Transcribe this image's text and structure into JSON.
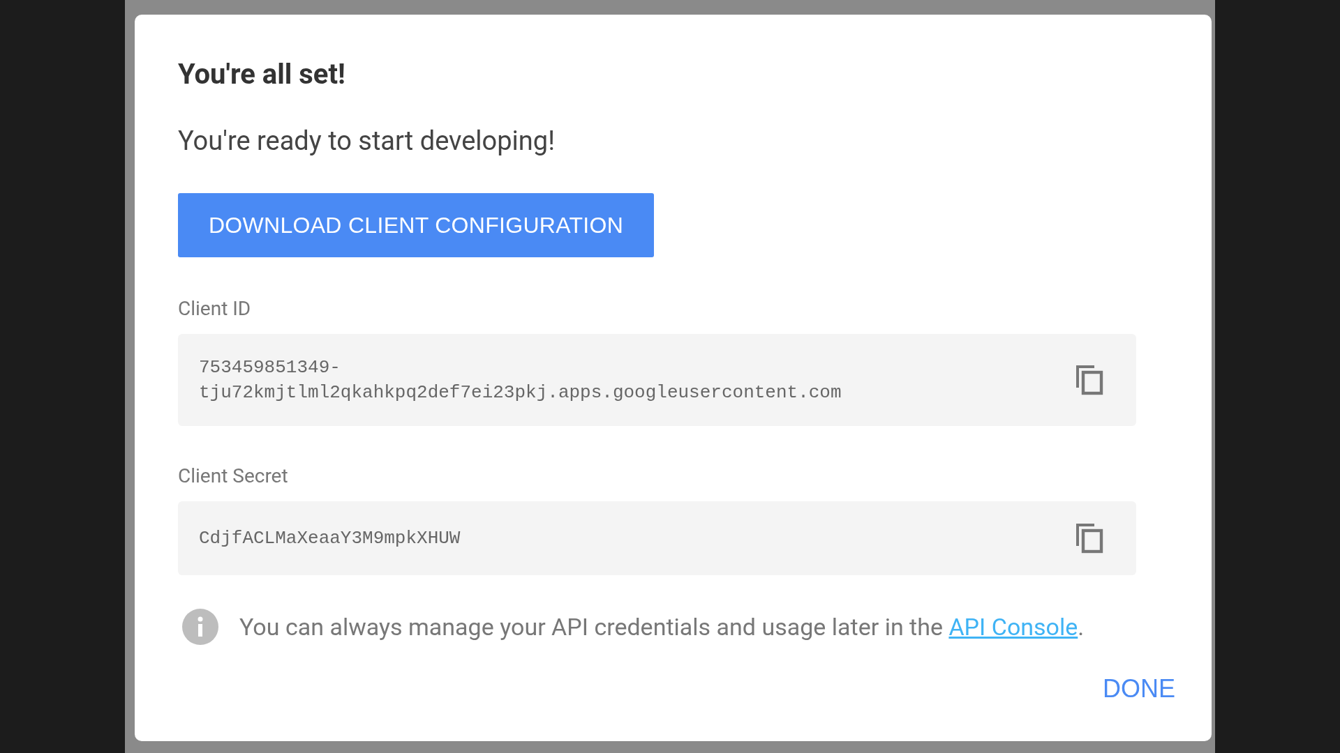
{
  "dialog": {
    "title": "You're all set!",
    "subtitle": "You're ready to start developing!",
    "download_button": "DOWNLOAD CLIENT CONFIGURATION",
    "fields": [
      {
        "label": "Client ID",
        "lines": [
          "753459851349-",
          "tju72kmjtlml2qkahkpq2def7ei23pkj.apps.googleusercontent.com"
        ]
      },
      {
        "label": "Client Secret",
        "lines": [
          "CdjfACLMaXeaaY3M9mpkXHUW"
        ]
      }
    ],
    "info": {
      "text": "You can always manage your API credentials and usage later in the ",
      "link": "API Console",
      "end": "."
    },
    "done_button": "DONE"
  }
}
